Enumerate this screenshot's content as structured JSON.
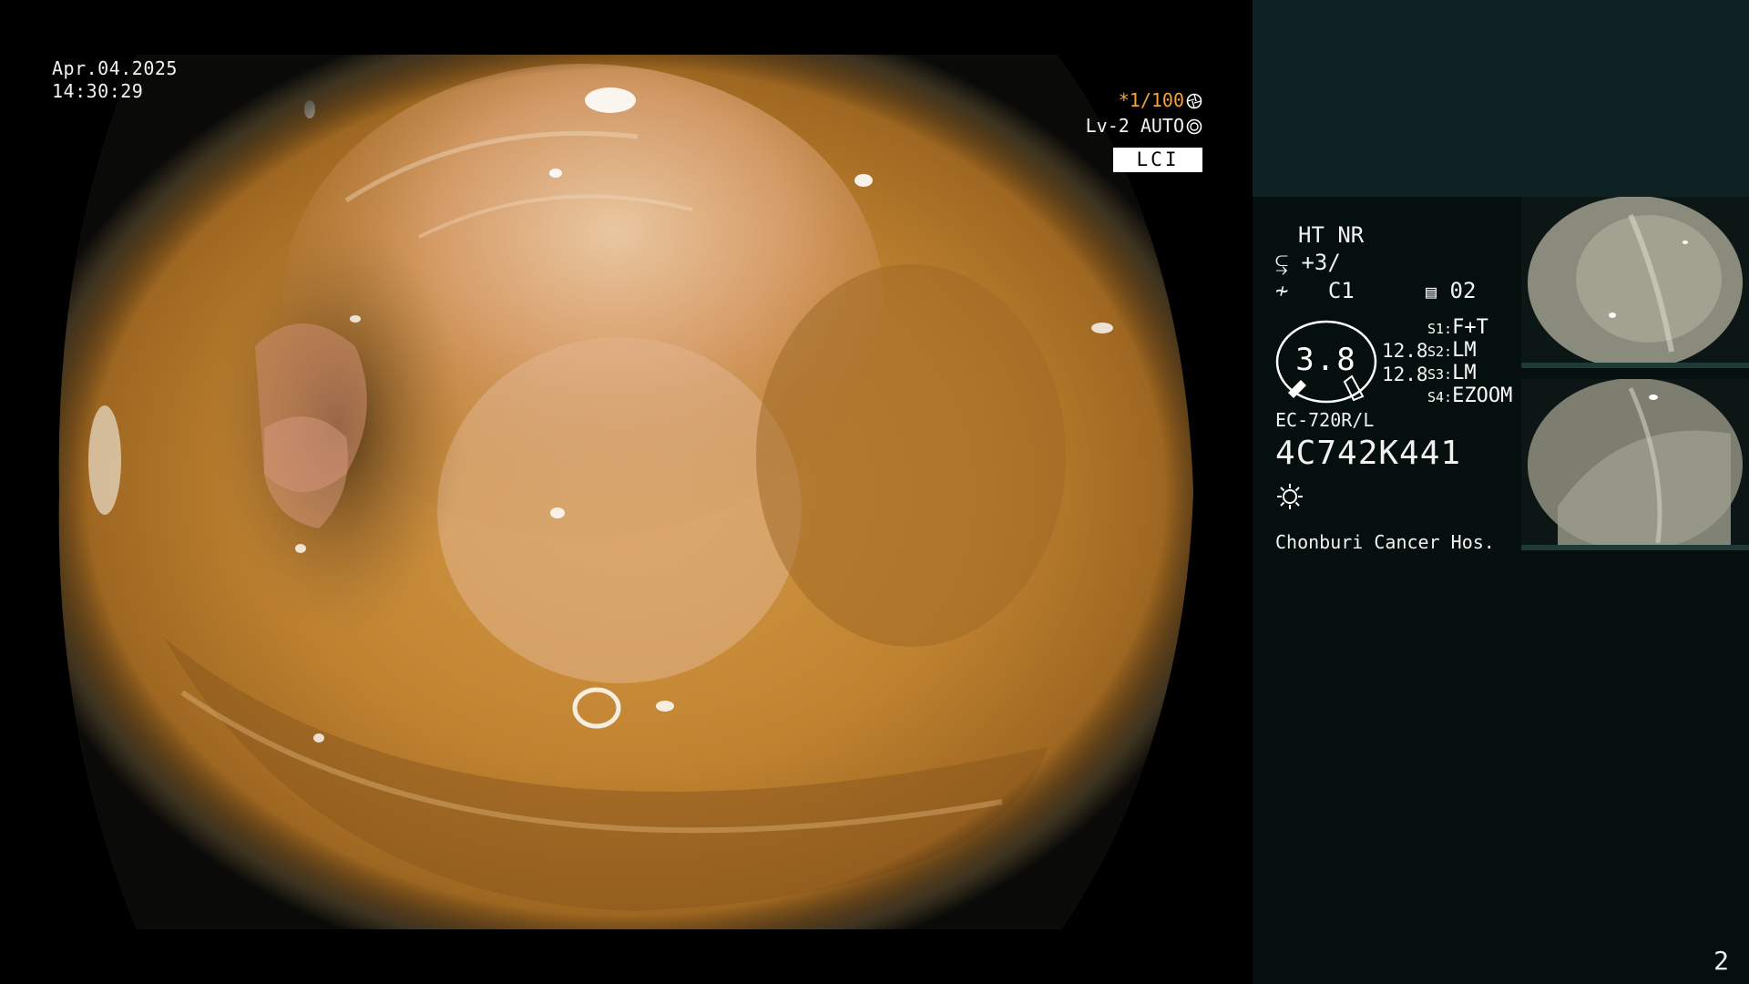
{
  "overlay": {
    "date": "Apr.04.2025",
    "time": "14:30:29",
    "shutter": "*1/100",
    "shutter_icon": "shutter-icon",
    "level": "Lv-2 AUTO",
    "level_icon": "iris-icon",
    "mode": "LCI"
  },
  "panel": {
    "image_mode": "HT NR",
    "enhancement": "+3/",
    "enhancement_icon": "structure-enhance-icon",
    "color": "C1",
    "color_icon": "color-mode-icon",
    "memory_slot": "02",
    "memory_icon": "memory-icon",
    "zoom": "3.8",
    "zoom_a": "12.8",
    "zoom_b": "12.8",
    "switches": [
      {
        "key": "S1:",
        "value": "F+T"
      },
      {
        "key": "S2:",
        "value": "LM"
      },
      {
        "key": "S3:",
        "value": "LM"
      },
      {
        "key": "S4:",
        "value": "EZOOM"
      }
    ],
    "scope_model": "EC-720R/L",
    "scope_serial": "4C742K441",
    "light_icon": "light-source-icon",
    "hospital": "Chonburi Cancer Hos."
  },
  "thumbnails": [
    {
      "name": "captured-image-1"
    },
    {
      "name": "captured-image-2"
    }
  ],
  "page_number": "2",
  "colors": {
    "background": "#000000",
    "panel": "#050f0d",
    "panel_top": "#0e2224",
    "shutter_text": "#f2a23a",
    "mucosa": "#b87a2a"
  }
}
